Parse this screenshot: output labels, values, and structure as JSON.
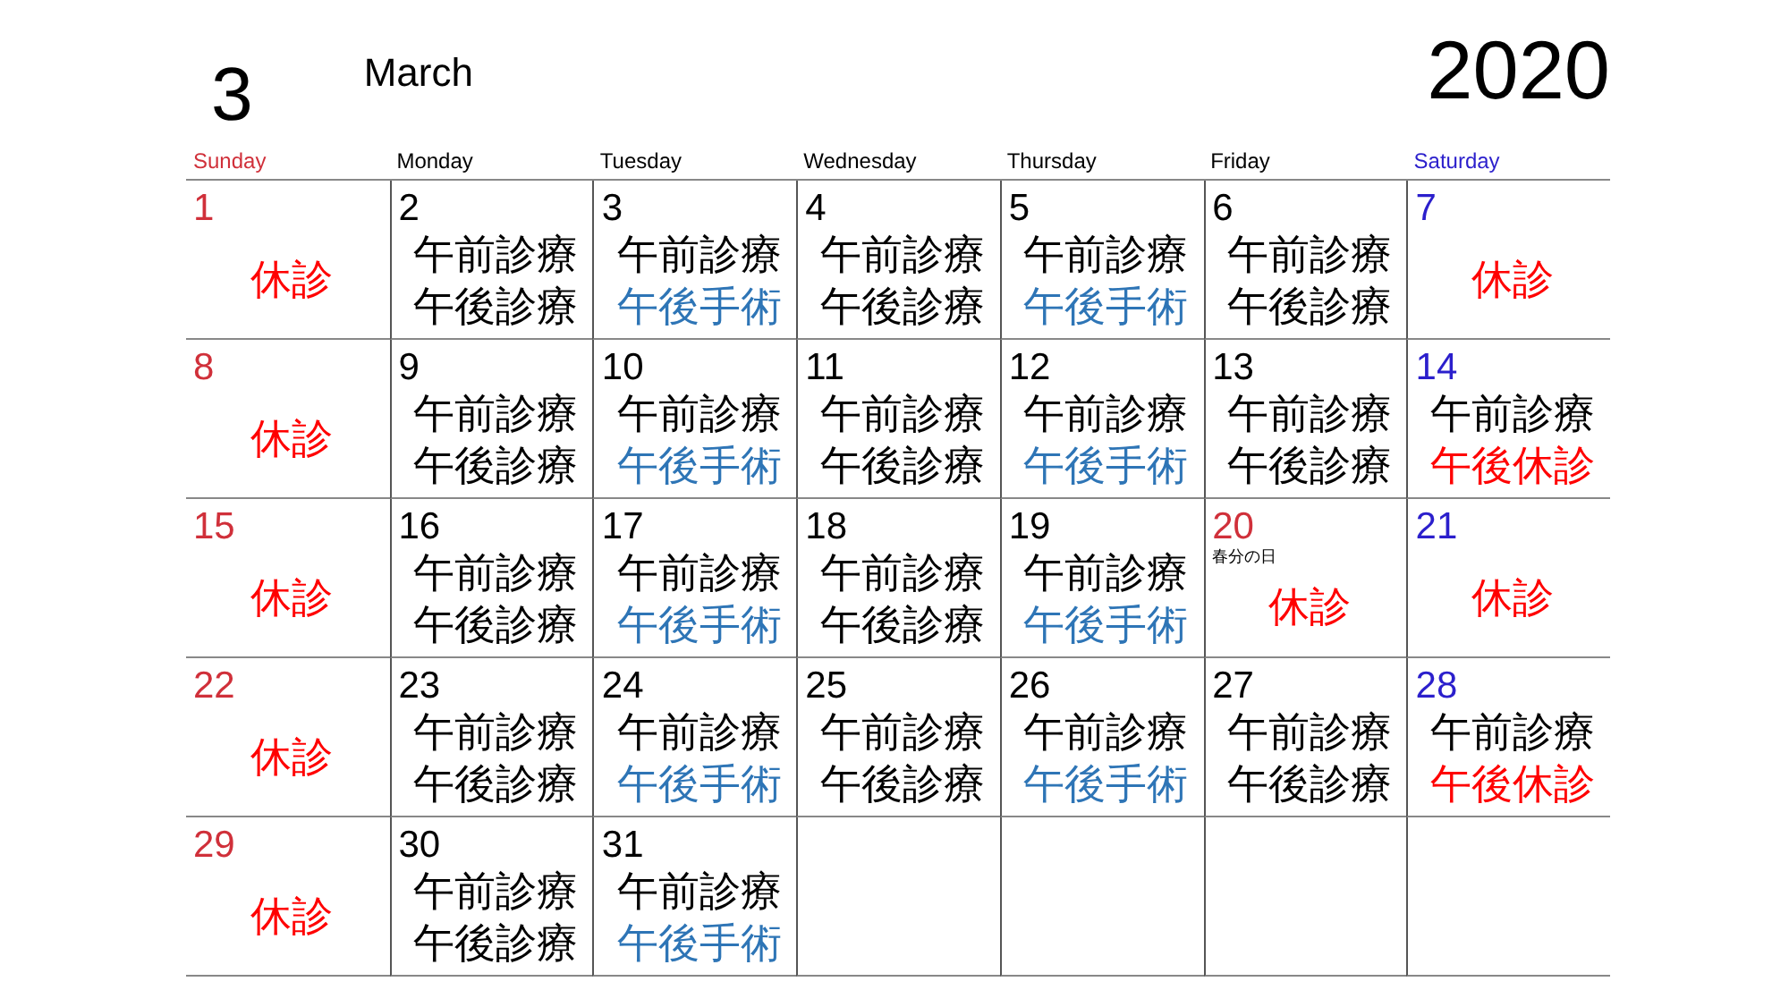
{
  "header": {
    "month_number": "3",
    "month_name": "March",
    "year": "2020"
  },
  "weekdays": [
    {
      "label": "Sunday",
      "kind": "sunday"
    },
    {
      "label": "Monday",
      "kind": "weekday"
    },
    {
      "label": "Tuesday",
      "kind": "weekday"
    },
    {
      "label": "Wednesday",
      "kind": "weekday"
    },
    {
      "label": "Thursday",
      "kind": "weekday"
    },
    {
      "label": "Friday",
      "kind": "weekday"
    },
    {
      "label": "Saturday",
      "kind": "saturday"
    }
  ],
  "weeks": [
    [
      {
        "day": "1",
        "kind": "sunday",
        "entries": [
          {
            "text": "休診",
            "kind": "closed"
          }
        ]
      },
      {
        "day": "2",
        "kind": "weekday",
        "entries": [
          {
            "text": "午前診療",
            "kind": "am"
          },
          {
            "text": "午後診療",
            "kind": "pm"
          }
        ]
      },
      {
        "day": "3",
        "kind": "weekday",
        "entries": [
          {
            "text": "午前診療",
            "kind": "am"
          },
          {
            "text": "午後手術",
            "kind": "surgery"
          }
        ]
      },
      {
        "day": "4",
        "kind": "weekday",
        "entries": [
          {
            "text": "午前診療",
            "kind": "am"
          },
          {
            "text": "午後診療",
            "kind": "pm"
          }
        ]
      },
      {
        "day": "5",
        "kind": "weekday",
        "entries": [
          {
            "text": "午前診療",
            "kind": "am"
          },
          {
            "text": "午後手術",
            "kind": "surgery"
          }
        ]
      },
      {
        "day": "6",
        "kind": "weekday",
        "entries": [
          {
            "text": "午前診療",
            "kind": "am"
          },
          {
            "text": "午後診療",
            "kind": "pm"
          }
        ]
      },
      {
        "day": "7",
        "kind": "saturday",
        "entries": [
          {
            "text": "休診",
            "kind": "closed"
          }
        ]
      }
    ],
    [
      {
        "day": "8",
        "kind": "sunday",
        "entries": [
          {
            "text": "休診",
            "kind": "closed"
          }
        ]
      },
      {
        "day": "9",
        "kind": "weekday",
        "entries": [
          {
            "text": "午前診療",
            "kind": "am"
          },
          {
            "text": "午後診療",
            "kind": "pm"
          }
        ]
      },
      {
        "day": "10",
        "kind": "weekday",
        "entries": [
          {
            "text": "午前診療",
            "kind": "am"
          },
          {
            "text": "午後手術",
            "kind": "surgery"
          }
        ]
      },
      {
        "day": "11",
        "kind": "weekday",
        "entries": [
          {
            "text": "午前診療",
            "kind": "am"
          },
          {
            "text": "午後診療",
            "kind": "pm"
          }
        ]
      },
      {
        "day": "12",
        "kind": "weekday",
        "entries": [
          {
            "text": "午前診療",
            "kind": "am"
          },
          {
            "text": "午後手術",
            "kind": "surgery"
          }
        ]
      },
      {
        "day": "13",
        "kind": "weekday",
        "entries": [
          {
            "text": "午前診療",
            "kind": "am"
          },
          {
            "text": "午後診療",
            "kind": "pm"
          }
        ]
      },
      {
        "day": "14",
        "kind": "saturday",
        "entries": [
          {
            "text": "午前診療",
            "kind": "am"
          },
          {
            "text": "午後休診",
            "kind": "pm_closed"
          }
        ]
      }
    ],
    [
      {
        "day": "15",
        "kind": "sunday",
        "entries": [
          {
            "text": "休診",
            "kind": "closed"
          }
        ]
      },
      {
        "day": "16",
        "kind": "weekday",
        "entries": [
          {
            "text": "午前診療",
            "kind": "am"
          },
          {
            "text": "午後診療",
            "kind": "pm"
          }
        ]
      },
      {
        "day": "17",
        "kind": "weekday",
        "entries": [
          {
            "text": "午前診療",
            "kind": "am"
          },
          {
            "text": "午後手術",
            "kind": "surgery"
          }
        ]
      },
      {
        "day": "18",
        "kind": "weekday",
        "entries": [
          {
            "text": "午前診療",
            "kind": "am"
          },
          {
            "text": "午後診療",
            "kind": "pm"
          }
        ]
      },
      {
        "day": "19",
        "kind": "weekday",
        "entries": [
          {
            "text": "午前診療",
            "kind": "am"
          },
          {
            "text": "午後手術",
            "kind": "surgery"
          }
        ]
      },
      {
        "day": "20",
        "kind": "holiday",
        "note": "春分の日",
        "entries": [
          {
            "text": "休診",
            "kind": "closed"
          }
        ]
      },
      {
        "day": "21",
        "kind": "saturday",
        "entries": [
          {
            "text": "休診",
            "kind": "closed"
          }
        ]
      }
    ],
    [
      {
        "day": "22",
        "kind": "sunday",
        "entries": [
          {
            "text": "休診",
            "kind": "closed"
          }
        ]
      },
      {
        "day": "23",
        "kind": "weekday",
        "entries": [
          {
            "text": "午前診療",
            "kind": "am"
          },
          {
            "text": "午後診療",
            "kind": "pm"
          }
        ]
      },
      {
        "day": "24",
        "kind": "weekday",
        "entries": [
          {
            "text": "午前診療",
            "kind": "am"
          },
          {
            "text": "午後手術",
            "kind": "surgery"
          }
        ]
      },
      {
        "day": "25",
        "kind": "weekday",
        "entries": [
          {
            "text": "午前診療",
            "kind": "am"
          },
          {
            "text": "午後診療",
            "kind": "pm"
          }
        ]
      },
      {
        "day": "26",
        "kind": "weekday",
        "entries": [
          {
            "text": "午前診療",
            "kind": "am"
          },
          {
            "text": "午後手術",
            "kind": "surgery"
          }
        ]
      },
      {
        "day": "27",
        "kind": "weekday",
        "entries": [
          {
            "text": "午前診療",
            "kind": "am"
          },
          {
            "text": "午後診療",
            "kind": "pm"
          }
        ]
      },
      {
        "day": "28",
        "kind": "saturday",
        "entries": [
          {
            "text": "午前診療",
            "kind": "am"
          },
          {
            "text": "午後休診",
            "kind": "pm_closed"
          }
        ]
      }
    ],
    [
      {
        "day": "29",
        "kind": "sunday",
        "entries": [
          {
            "text": "休診",
            "kind": "closed"
          }
        ]
      },
      {
        "day": "30",
        "kind": "weekday",
        "entries": [
          {
            "text": "午前診療",
            "kind": "am"
          },
          {
            "text": "午後診療",
            "kind": "pm"
          }
        ]
      },
      {
        "day": "31",
        "kind": "weekday",
        "entries": [
          {
            "text": "午前診療",
            "kind": "am"
          },
          {
            "text": "午後手術",
            "kind": "surgery"
          }
        ]
      }
    ]
  ]
}
